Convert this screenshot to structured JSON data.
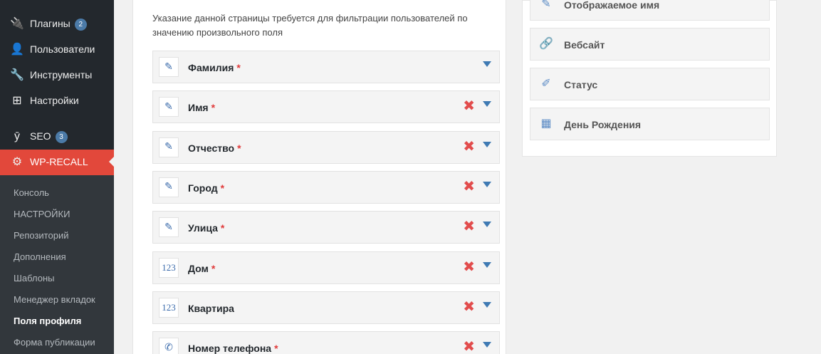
{
  "sidebar": {
    "menu": [
      {
        "label": "Плагины",
        "badge": "2",
        "icon": "plugins-icon"
      },
      {
        "label": "Пользователи",
        "badge": "",
        "icon": "users-icon"
      },
      {
        "label": "Инструменты",
        "badge": "",
        "icon": "tools-icon"
      },
      {
        "label": "Настройки",
        "badge": "",
        "icon": "settings-icon"
      },
      {
        "label": "SEO",
        "badge": "3",
        "icon": "yoast-icon"
      },
      {
        "label": "WP-RECALL",
        "badge": "",
        "icon": "gear-icon"
      }
    ],
    "submenu": [
      "Консоль",
      "НАСТРОЙКИ",
      "Репозиторий",
      "Дополнения",
      "Шаблоны",
      "Менеджер вкладок",
      "Поля профиля",
      "Форма публикации"
    ],
    "current_submenu": "Поля профиля"
  },
  "main": {
    "note": "Указание данной страницы требуется для фильтрации пользователей по значению произвольного поля",
    "fields": [
      {
        "icon": "pencil-icon",
        "glyph": "✎",
        "label": "Фамилия",
        "required": "*",
        "deletable": false
      },
      {
        "icon": "pencil-icon",
        "glyph": "✎",
        "label": "Имя",
        "required": "*",
        "deletable": true
      },
      {
        "icon": "pencil-icon",
        "glyph": "✎",
        "label": "Отчество",
        "required": "*",
        "deletable": true
      },
      {
        "icon": "pencil-icon",
        "glyph": "✎",
        "label": "Город",
        "required": "*",
        "deletable": true
      },
      {
        "icon": "pencil-icon",
        "glyph": "✎",
        "label": "Улица",
        "required": "*",
        "deletable": true
      },
      {
        "icon": "number-icon",
        "glyph": "123",
        "label": "Дом",
        "required": "*",
        "deletable": true
      },
      {
        "icon": "number-icon",
        "glyph": "123",
        "label": "Квартира",
        "required": "",
        "deletable": true
      },
      {
        "icon": "phone-icon",
        "glyph": "✆",
        "label": "Номер телефона",
        "required": "*",
        "deletable": true
      }
    ],
    "delete_glyph": "✖"
  },
  "available": {
    "fields": [
      {
        "icon": "pencil-icon",
        "glyph": "✎",
        "label": "Отображаемое имя"
      },
      {
        "icon": "link-icon",
        "glyph": "🔗",
        "label": "Вебсайт"
      },
      {
        "icon": "note-icon",
        "glyph": "✐",
        "label": "Статус"
      },
      {
        "icon": "calendar-icon",
        "glyph": "▦",
        "label": "День Рождения"
      }
    ]
  },
  "colors": {
    "accent": "#e2483b",
    "sidebar": "#23282d",
    "link": "#3f7ab3",
    "delete": "#e24c4c"
  }
}
